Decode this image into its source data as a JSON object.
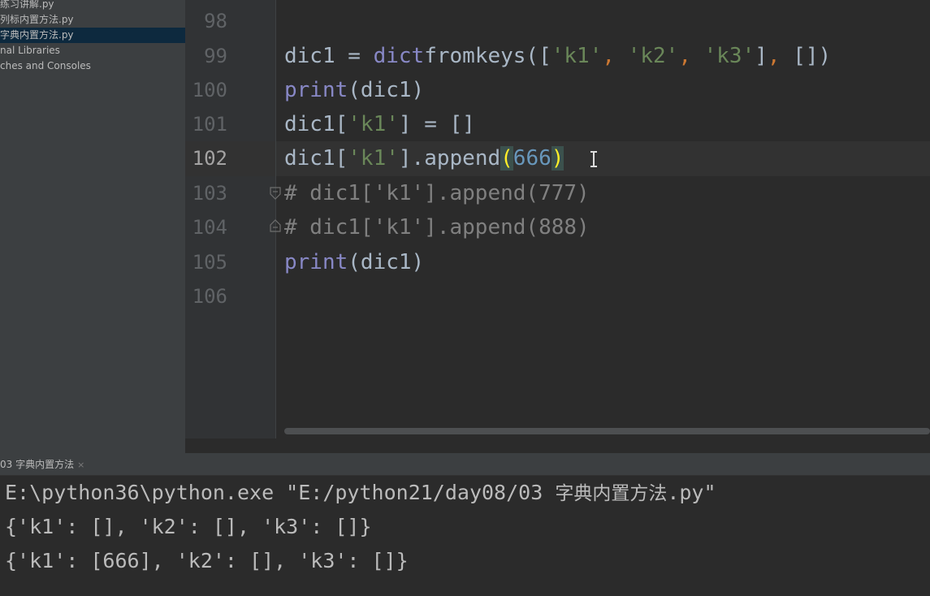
{
  "project_tree": {
    "items": [
      {
        "label": "练习讲解.py",
        "selected": false
      },
      {
        "label": "列标内置方法.py",
        "selected": false
      },
      {
        "label": "字典内置方法.py",
        "selected": true
      },
      {
        "label": "nal Libraries",
        "selected": false
      },
      {
        "label": "ches and Consoles",
        "selected": false
      }
    ]
  },
  "editor": {
    "current_line": "102",
    "line_numbers": [
      "98",
      "99",
      "100",
      "101",
      "102",
      "103",
      "104",
      "105",
      "106"
    ],
    "code": {
      "l99": {
        "a": "dic1 = ",
        "b": "dict",
        ".": ".",
        "c": "fromkeys([",
        "d": "'k1'",
        "e": ", ",
        "f": "'k2'",
        "g": ", ",
        "h": "'k3'",
        "i": "], ",
        "j": ", ",
        "k": "[])"
      },
      "l100": {
        "a": "print",
        "b": "(dic1)"
      },
      "l101": {
        "a": "dic1[",
        "b": "'k1'",
        "c": "] = []"
      },
      "l102": {
        "a": "dic1[",
        "b": "'k1'",
        "c": "].append",
        "d": "(",
        "e": "666",
        "f": ")"
      },
      "l103": "# dic1['k1'].append(777)",
      "l104": "# dic1['k1'].append(888)",
      "l105": {
        "a": "print",
        "b": "(dic1)"
      }
    }
  },
  "run_panel": {
    "tab_label": "03 字典内置方法",
    "close_glyph": "×",
    "console_lines": [
      {
        "a": "E:\\python36\\python.exe \"E:/python21/day08/03 ",
        "b": "字典内置方法",
        "c": ".py\""
      },
      {
        "a": "{'k1': [], 'k2': [], 'k3': []}"
      },
      {
        "a": "{'k1': [666], 'k2': [], 'k3': []}"
      }
    ]
  },
  "colors": {
    "keyword": "#8888c6",
    "string": "#6a8759",
    "number": "#6897bb",
    "comment": "#808080",
    "default": "#a9b7c6",
    "brace_match": "#ffef28"
  }
}
